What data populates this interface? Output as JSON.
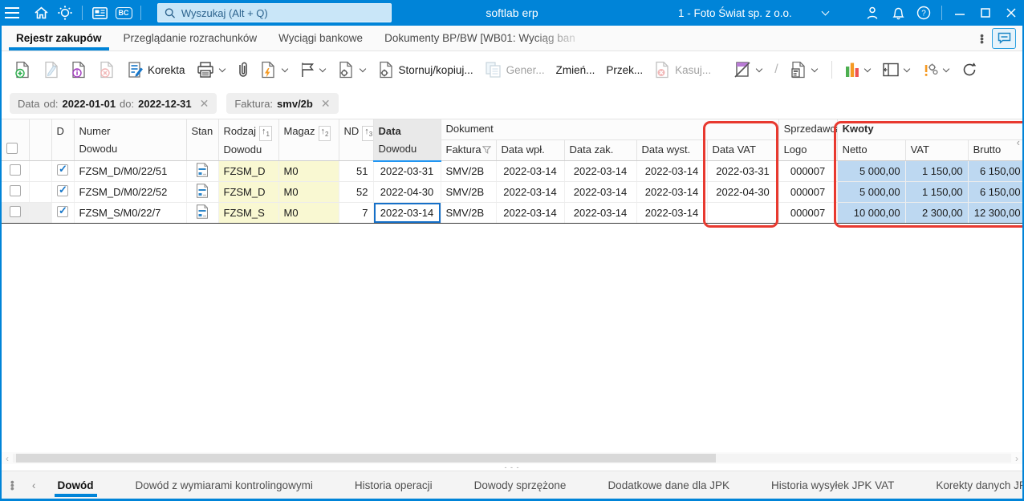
{
  "colors": {
    "accent": "#0084d8",
    "annotation_red": "#e8392f",
    "cell_yellow": "#f9f8d2",
    "cell_blue": "#bdd8f1"
  },
  "topbar": {
    "app_title": "softlab erp",
    "company": "1 - Foto Świat sp. z o.o.",
    "search_placeholder": "Wyszukaj (Alt + Q)",
    "bc_badge": "BC"
  },
  "tabs": [
    {
      "label": "Rejestr zakupów"
    },
    {
      "label": "Przeglądanie rozrachunków"
    },
    {
      "label": "Wyciągi bankowe"
    },
    {
      "label": "Dokumenty BP/BW [WB01: Wyciąg ban"
    }
  ],
  "toolbar": {
    "korekta_label": "Korekta",
    "stornuj_label": "Stornuj/kopiuj...",
    "gener_label": "Gener...",
    "zmien_label": "Zmień...",
    "przek_label": "Przek...",
    "kasuj_label": "Kasuj...",
    "slash_divider": "/"
  },
  "filters": {
    "date_chip": {
      "label": "Data",
      "od_label": "od:",
      "od_value": "2022-01-01",
      "do_label": "do:",
      "do_value": "2022-12-31"
    },
    "faktura_chip": {
      "label": "Faktura:",
      "value": "smv/2b"
    }
  },
  "table": {
    "headers": {
      "d": "D",
      "numer_line1": "Numer",
      "numer_line2": "Dowodu",
      "stan": "Stan",
      "rodzaj_line1": "Rodzaj",
      "rodzaj_line2": "Dowodu",
      "rodzaj_sort": "1",
      "magaz": "Magaz",
      "magaz_sort": "2",
      "nd": "ND",
      "nd_sort": "3",
      "data_line1": "Data",
      "data_line2": "Dowodu",
      "dokument_group": "Dokument",
      "faktura": "Faktura",
      "data_wpl": "Data wpł.",
      "data_zak": "Data zak.",
      "data_wyst": "Data wyst.",
      "data_vat": "Data VAT",
      "sprzedawca_group": "Sprzedawca",
      "logo": "Logo",
      "kwoty_group": "Kwoty",
      "netto": "Netto",
      "vat": "VAT",
      "brutto": "Brutto"
    },
    "rows": [
      {
        "numer": "FZSM_D/M0/22/51",
        "rodzaj": "FZSM_D",
        "magaz": "M0",
        "nd": "51",
        "data_dowodu": "2022-03-31",
        "faktura": "SMV/2B",
        "data_wpl": "2022-03-14",
        "data_zak": "2022-03-14",
        "data_wyst": "2022-03-14",
        "data_vat": "2022-03-31",
        "logo": "000007",
        "netto": "5 000,00",
        "vat": "1 150,00",
        "brutto": "6 150,00"
      },
      {
        "numer": "FZSM_D/M0/22/52",
        "rodzaj": "FZSM_D",
        "magaz": "M0",
        "nd": "52",
        "data_dowodu": "2022-04-30",
        "faktura": "SMV/2B",
        "data_wpl": "2022-03-14",
        "data_zak": "2022-03-14",
        "data_wyst": "2022-03-14",
        "data_vat": "2022-04-30",
        "logo": "000007",
        "netto": "5 000,00",
        "vat": "1 150,00",
        "brutto": "6 150,00"
      },
      {
        "numer": "FZSM_S/M0/22/7",
        "rodzaj": "FZSM_S",
        "magaz": "M0",
        "nd": "7",
        "data_dowodu": "2022-03-14",
        "faktura": "SMV/2B",
        "data_wpl": "2022-03-14",
        "data_zak": "2022-03-14",
        "data_wyst": "2022-03-14",
        "data_vat": "",
        "logo": "000007",
        "netto": "10 000,00",
        "vat": "2 300,00",
        "brutto": "12 300,00"
      }
    ]
  },
  "bottom_tabs": [
    "Dowód",
    "Dowód z wymiarami kontrolingowymi",
    "Historia operacji",
    "Dowody sprzężone",
    "Dodatkowe dane dla JPK",
    "Historia wysyłek JPK VAT",
    "Korekty danych JPI"
  ]
}
